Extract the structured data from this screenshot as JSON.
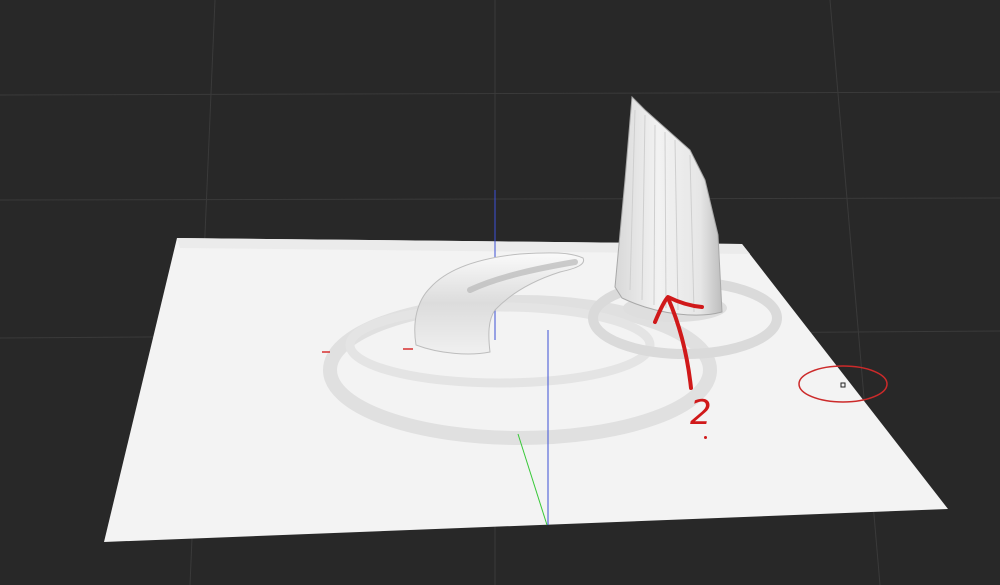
{
  "viewport": {
    "background": "#282828",
    "grid_color": "#3a3a3a",
    "plane_color": "#f3f3f3",
    "axis_colors": {
      "x": "#d62f2f",
      "y": "#37c837",
      "z": "#3b4fd6"
    }
  },
  "objects": [
    {
      "name": "plane",
      "kind": "subdivided-plane"
    },
    {
      "name": "curved-hook",
      "kind": "sculpted-mesh"
    },
    {
      "name": "vertical-blade",
      "kind": "extruded-mesh"
    }
  ],
  "annotation": {
    "color": "#d0191a",
    "text": "2"
  },
  "brush_cursor": {
    "color": "#cc2a2a"
  }
}
